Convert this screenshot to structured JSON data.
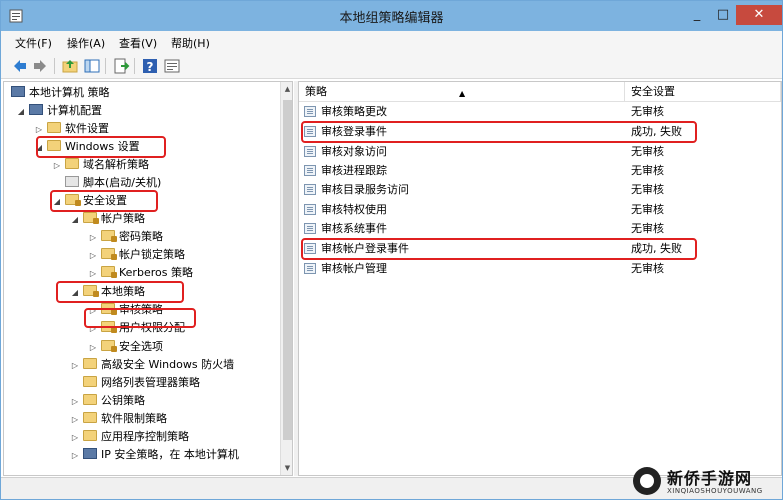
{
  "window": {
    "title": "本地组策略编辑器",
    "minimize": "_",
    "maximize": "□",
    "close": "✕"
  },
  "menu": [
    {
      "label": "文件(F)"
    },
    {
      "label": "操作(A)"
    },
    {
      "label": "查看(V)"
    },
    {
      "label": "帮助(H)"
    }
  ],
  "tree": [
    {
      "label": "本地计算机 策略",
      "arrow": "",
      "icon": "computer-icon"
    },
    {
      "label": "计算机配置",
      "arrow": "◢",
      "icon": "computer-icon"
    },
    {
      "label": "软件设置",
      "arrow": "▷",
      "icon": "folder-icon"
    },
    {
      "label": "Windows 设置",
      "arrow": "◢",
      "icon": "folder-icon"
    },
    {
      "label": "域名解析策略",
      "arrow": "▷",
      "icon": "folder-icon"
    },
    {
      "label": "脚本(启动/关机)",
      "arrow": "",
      "icon": "script-icon"
    },
    {
      "label": "安全设置",
      "arrow": "◢",
      "icon": "security-folder-icon"
    },
    {
      "label": "帐户策略",
      "arrow": "◢",
      "icon": "lock-folder-icon"
    },
    {
      "label": "密码策略",
      "arrow": "▷",
      "icon": "lock-folder-icon"
    },
    {
      "label": "帐户锁定策略",
      "arrow": "▷",
      "icon": "lock-folder-icon"
    },
    {
      "label": "Kerberos 策略",
      "arrow": "▷",
      "icon": "lock-folder-icon"
    },
    {
      "label": "本地策略",
      "arrow": "◢",
      "icon": "lock-folder-icon"
    },
    {
      "label": "审核策略",
      "arrow": "▷",
      "icon": "lock-folder-icon"
    },
    {
      "label": "用户权限分配",
      "arrow": "▷",
      "icon": "lock-folder-icon"
    },
    {
      "label": "安全选项",
      "arrow": "▷",
      "icon": "lock-folder-icon"
    },
    {
      "label": "高级安全 Windows 防火墙",
      "arrow": "▷",
      "icon": "folder-icon"
    },
    {
      "label": "网络列表管理器策略",
      "arrow": "",
      "icon": "folder-icon"
    },
    {
      "label": "公钥策略",
      "arrow": "▷",
      "icon": "folder-icon"
    },
    {
      "label": "软件限制策略",
      "arrow": "▷",
      "icon": "folder-icon"
    },
    {
      "label": "应用程序控制策略",
      "arrow": "▷",
      "icon": "folder-icon"
    },
    {
      "label": "IP 安全策略，在 本地计算机",
      "arrow": "▷",
      "icon": "ip-security-icon"
    }
  ],
  "columns": {
    "policy": "策略",
    "setting": "安全设置",
    "sort_arrow": "▲"
  },
  "policies": [
    {
      "name": "审核策略更改",
      "value": "无审核"
    },
    {
      "name": "审核登录事件",
      "value": "成功, 失败"
    },
    {
      "name": "审核对象访问",
      "value": "无审核"
    },
    {
      "name": "审核进程跟踪",
      "value": "无审核"
    },
    {
      "name": "审核目录服务访问",
      "value": "无审核"
    },
    {
      "name": "审核特权使用",
      "value": "无审核"
    },
    {
      "name": "审核系统事件",
      "value": "无审核"
    },
    {
      "name": "审核帐户登录事件",
      "value": "成功, 失败"
    },
    {
      "name": "审核帐户管理",
      "value": "无审核"
    }
  ],
  "watermark": {
    "name": "新侨手游网",
    "sub": "XINQIAOSHOUYOUWANG"
  },
  "colors": {
    "titlebar": "#7db3e0",
    "highlight": "#e02020",
    "close": "#c74a3e"
  }
}
